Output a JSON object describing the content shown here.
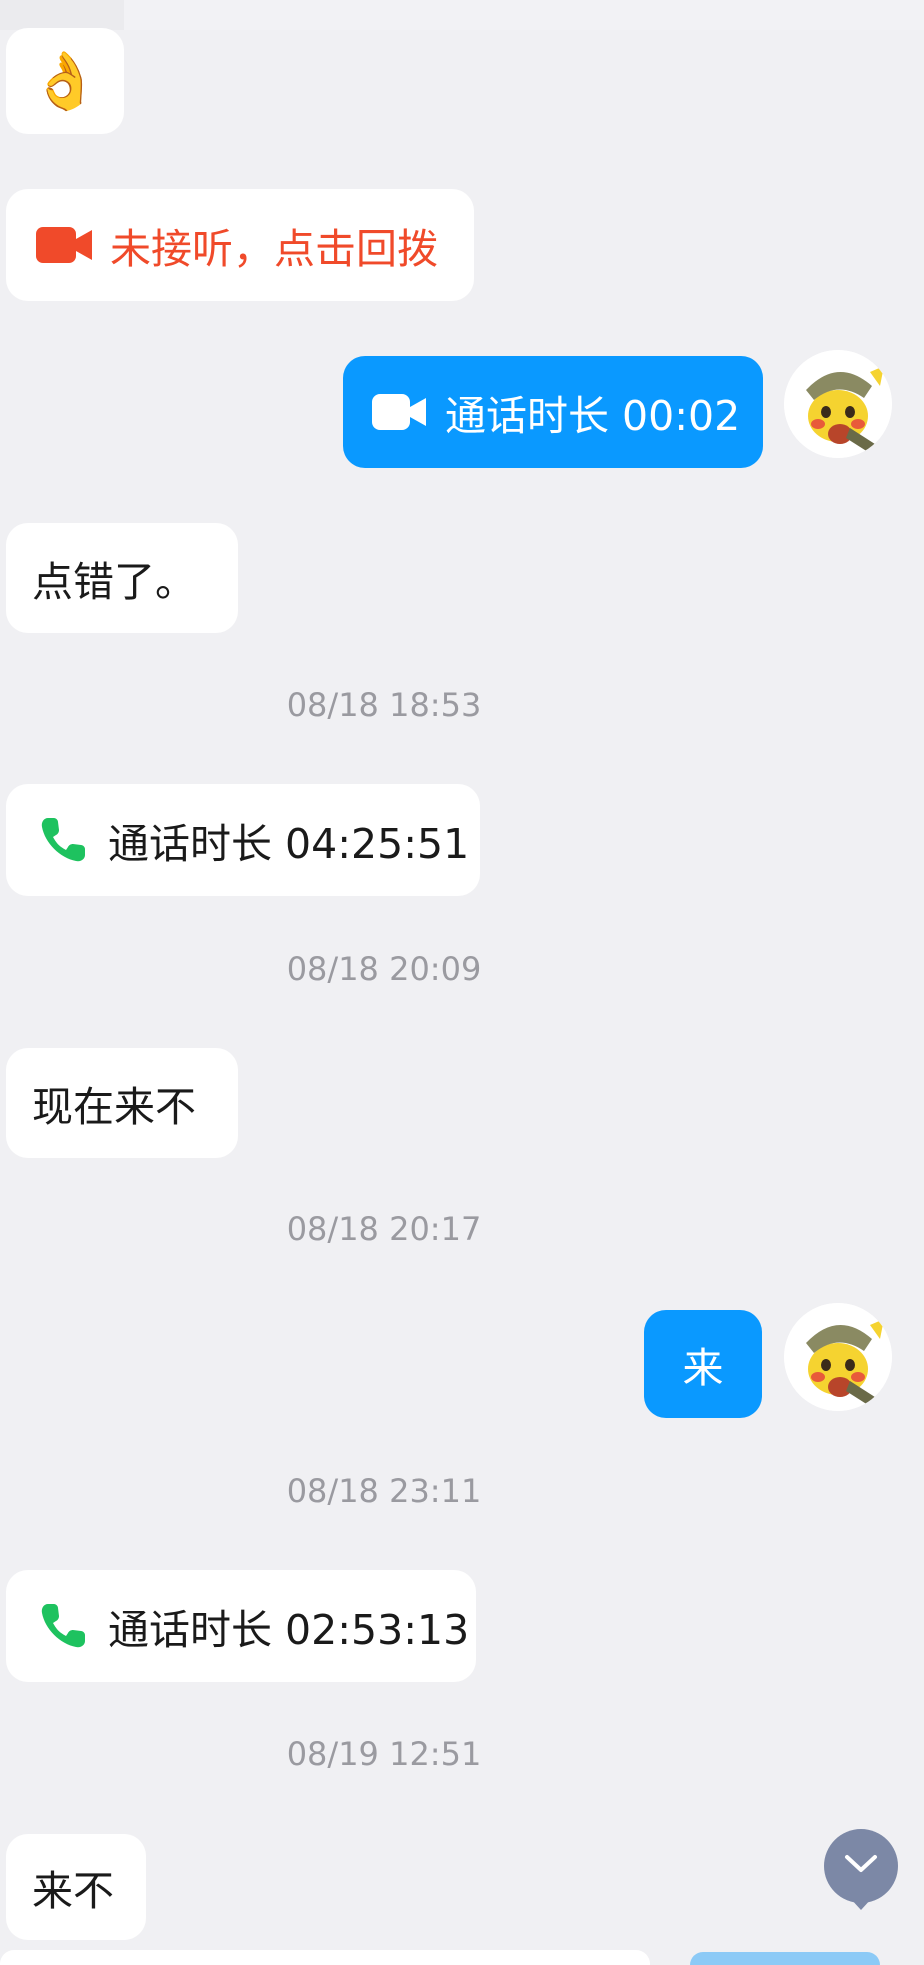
{
  "messages": {
    "m1": {
      "emoji": "👌"
    },
    "m2": {
      "text": "未接听，点击回拨",
      "color": "#f04a2a"
    },
    "m3": {
      "text": "通话时长 00:02"
    },
    "m4": {
      "text": "点错了。"
    },
    "m5": {
      "text": "通话时长 04:25:51"
    },
    "m6": {
      "text": "现在来不"
    },
    "m7": {
      "text": "来"
    },
    "m8": {
      "text": "通话时长 02:53:13"
    },
    "m9": {
      "text": "来不"
    }
  },
  "timestamps": {
    "t1": "08/18 18:53",
    "t2": "08/18 20:09",
    "t3": "08/18 20:17",
    "t4": "08/18 23:11",
    "t5": "08/19 12:51"
  },
  "colors": {
    "background": "#f0f0f3",
    "outgoing_bubble": "#0a99ff",
    "incoming_bubble": "#ffffff",
    "missed_call": "#f04a2a",
    "phone_icon": "#1ec25f",
    "scroll_button": "#7c88a6"
  },
  "icons": {
    "video": "video-camera-icon",
    "phone": "phone-handset-icon",
    "scroll": "chevron-down-icon"
  }
}
